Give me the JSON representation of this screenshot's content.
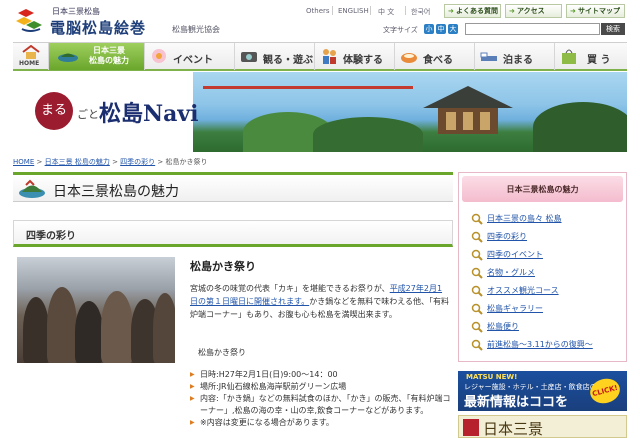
{
  "header": {
    "logo_small": "日本三景松島",
    "logo_main": "電脳松島絵巻",
    "logo_sub": "松島観光協会",
    "languages": [
      "Others",
      "ENGLISH",
      "中 文",
      "한국어"
    ],
    "quick_buttons": [
      "よくある質問",
      "アクセス",
      "サイトマップ"
    ],
    "font_size_label": "文字サイズ",
    "font_sizes": [
      "小",
      "中",
      "大"
    ],
    "search_placeholder": "",
    "search_button": "検索"
  },
  "nav": {
    "home": "HOME",
    "active_line1": "日本三景",
    "active_line2": "松島の魅力",
    "items": [
      "イベント",
      "観る・遊ぶ",
      "体験する",
      "食べる",
      "泊まる",
      "買 う"
    ]
  },
  "banner": {
    "maru": "まる",
    "goto": "ごと",
    "title": "松島Navi"
  },
  "breadcrumb": {
    "home": "HOME",
    "level1": "日本三景 松島の魅力",
    "level2": "四季の彩り",
    "current": "松島かき祭り",
    "sep": ">"
  },
  "main": {
    "section_title": "日本三景松島の魅力",
    "subsection_title": "四季の彩り",
    "article_title": "松島かき祭り",
    "body_1": "宮城の冬の味覚の代表「カキ」を堪能できるお祭りが、",
    "body_link": "平成27年2月1日の第１日曜日に開催されます。",
    "body_2": "かき鍋などを無料で味わえる他、「有料炉端コーナー」もあり、お腹も心も松島を満喫出来ます。",
    "caption": "松島かき祭り",
    "bullets": [
      "日時:H27年2月1日(日)9:00～14：00",
      "場所:JR仙石線松島海岸駅前グリーン広場",
      "内容:「かき鍋」などの無料試食のほか、「かき」の販売、「有料炉端コーナー」,松島の海の幸・山の幸,飲食コーナーなどがあります。",
      "※内容は変更になる場合があります。"
    ]
  },
  "sidebar": {
    "title": "日本三景松島の魅力",
    "items": [
      "日本三景の島々 松島",
      "四季の彩り",
      "四季のイベント",
      "名物・グルメ",
      "オススメ観光コース",
      "松島ギャラリー",
      "松島便り",
      "前進松島～3.11からの復興～"
    ]
  },
  "promo": {
    "line1": "MATSU NEW!",
    "line2": "レジャー施設・ホテル・土産店・飲食店の",
    "line3": "最新情報はココを",
    "click": "CLICK!",
    "banner2": "日本三景"
  },
  "colors": {
    "accent_green": "#6aa62c",
    "brand_navy": "#1f3f7a",
    "maru_red": "#9b1b2f",
    "link_blue": "#2255aa"
  }
}
